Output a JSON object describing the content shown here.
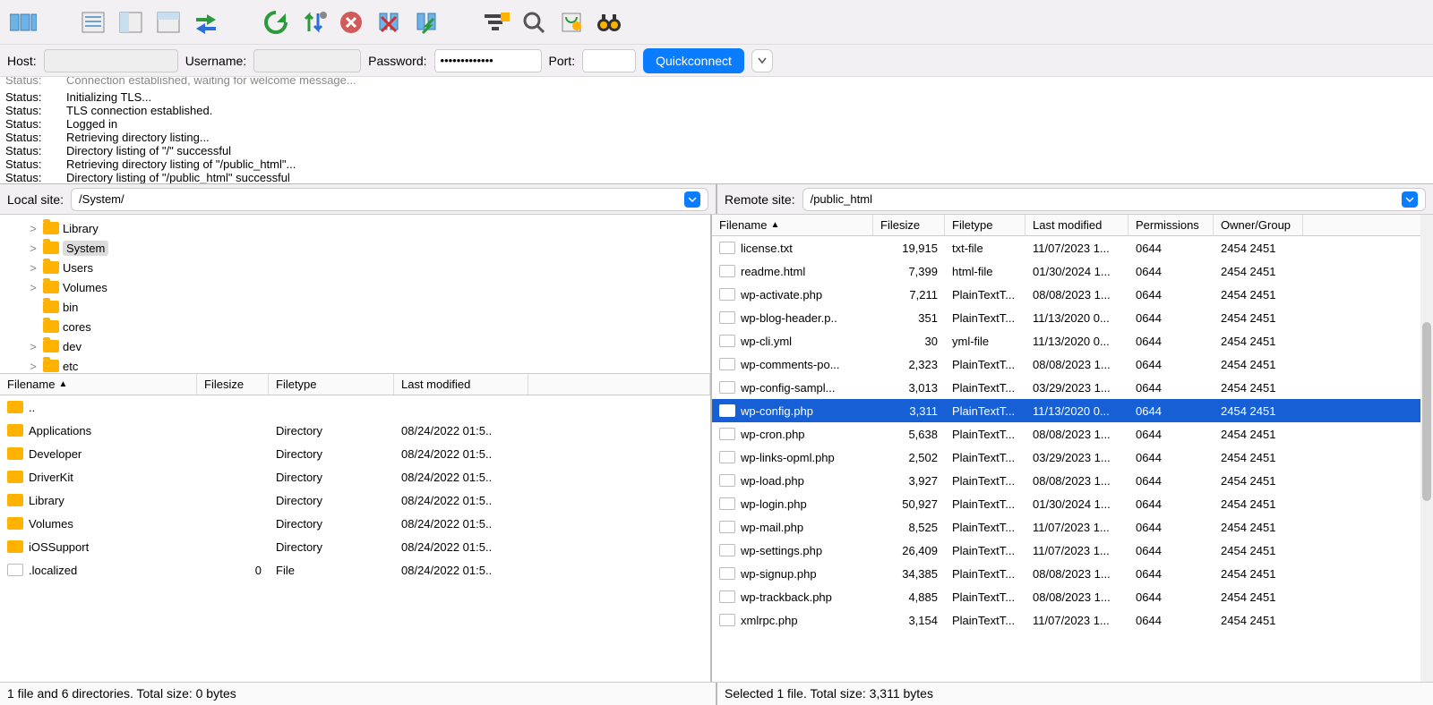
{
  "quickconnect": {
    "host_label": "Host:",
    "username_label": "Username:",
    "password_label": "Password:",
    "port_label": "Port:",
    "button": "Quickconnect",
    "password_mask": "•••••••••••••"
  },
  "log": [
    {
      "k": "Status:",
      "v": "Connection established, waiting for welcome message..."
    },
    {
      "k": "Status:",
      "v": "Initializing TLS..."
    },
    {
      "k": "Status:",
      "v": "TLS connection established."
    },
    {
      "k": "Status:",
      "v": "Logged in"
    },
    {
      "k": "Status:",
      "v": "Retrieving directory listing..."
    },
    {
      "k": "Status:",
      "v": "Directory listing of \"/\" successful"
    },
    {
      "k": "Status:",
      "v": "Retrieving directory listing of \"/public_html\"..."
    },
    {
      "k": "Status:",
      "v": "Directory listing of \"/public_html\" successful"
    }
  ],
  "local": {
    "site_label": "Local site:",
    "path": "/System/",
    "tree": [
      {
        "expander": ">",
        "name": "Library",
        "sel": false
      },
      {
        "expander": ">",
        "name": "System",
        "sel": true
      },
      {
        "expander": ">",
        "name": "Users",
        "sel": false
      },
      {
        "expander": ">",
        "name": "Volumes",
        "sel": false
      },
      {
        "expander": "",
        "name": "bin",
        "sel": false
      },
      {
        "expander": "",
        "name": "cores",
        "sel": false
      },
      {
        "expander": ">",
        "name": "dev",
        "sel": false
      },
      {
        "expander": ">",
        "name": "etc",
        "sel": false
      }
    ],
    "cols": {
      "name": "Filename",
      "size": "Filesize",
      "type": "Filetype",
      "mod": "Last modified"
    },
    "files": [
      {
        "icon": "folder",
        "name": "..",
        "size": "",
        "type": "",
        "mod": ""
      },
      {
        "icon": "folder",
        "name": "Applications",
        "size": "",
        "type": "Directory",
        "mod": "08/24/2022 01:5.."
      },
      {
        "icon": "folder",
        "name": "Developer",
        "size": "",
        "type": "Directory",
        "mod": "08/24/2022 01:5.."
      },
      {
        "icon": "folder",
        "name": "DriverKit",
        "size": "",
        "type": "Directory",
        "mod": "08/24/2022 01:5.."
      },
      {
        "icon": "folder",
        "name": "Library",
        "size": "",
        "type": "Directory",
        "mod": "08/24/2022 01:5.."
      },
      {
        "icon": "folder",
        "name": "Volumes",
        "size": "",
        "type": "Directory",
        "mod": "08/24/2022 01:5.."
      },
      {
        "icon": "folder",
        "name": "iOSSupport",
        "size": "",
        "type": "Directory",
        "mod": "08/24/2022 01:5.."
      },
      {
        "icon": "file",
        "name": ".localized",
        "size": "0",
        "type": "File",
        "mod": "08/24/2022 01:5.."
      }
    ],
    "footer": "1 file and 6 directories. Total size: 0 bytes"
  },
  "remote": {
    "site_label": "Remote site:",
    "path": "/public_html",
    "cols": {
      "name": "Filename",
      "size": "Filesize",
      "type": "Filetype",
      "mod": "Last modified",
      "perm": "Permissions",
      "own": "Owner/Group"
    },
    "files": [
      {
        "icon": "file",
        "name": "license.txt",
        "size": "19,915",
        "type": "txt-file",
        "mod": "11/07/2023 1...",
        "perm": "0644",
        "own": "2454 2451",
        "sel": false
      },
      {
        "icon": "file",
        "name": "readme.html",
        "size": "7,399",
        "type": "html-file",
        "mod": "01/30/2024 1...",
        "perm": "0644",
        "own": "2454 2451",
        "sel": false
      },
      {
        "icon": "file",
        "name": "wp-activate.php",
        "size": "7,211",
        "type": "PlainTextT...",
        "mod": "08/08/2023 1...",
        "perm": "0644",
        "own": "2454 2451",
        "sel": false
      },
      {
        "icon": "file",
        "name": "wp-blog-header.p..",
        "size": "351",
        "type": "PlainTextT...",
        "mod": "11/13/2020 0...",
        "perm": "0644",
        "own": "2454 2451",
        "sel": false
      },
      {
        "icon": "file",
        "name": "wp-cli.yml",
        "size": "30",
        "type": "yml-file",
        "mod": "11/13/2020 0...",
        "perm": "0644",
        "own": "2454 2451",
        "sel": false
      },
      {
        "icon": "file",
        "name": "wp-comments-po...",
        "size": "2,323",
        "type": "PlainTextT...",
        "mod": "08/08/2023 1...",
        "perm": "0644",
        "own": "2454 2451",
        "sel": false
      },
      {
        "icon": "file",
        "name": "wp-config-sampl...",
        "size": "3,013",
        "type": "PlainTextT...",
        "mod": "03/29/2023 1...",
        "perm": "0644",
        "own": "2454 2451",
        "sel": false
      },
      {
        "icon": "file",
        "name": "wp-config.php",
        "size": "3,311",
        "type": "PlainTextT...",
        "mod": "11/13/2020 0...",
        "perm": "0644",
        "own": "2454 2451",
        "sel": true
      },
      {
        "icon": "file",
        "name": "wp-cron.php",
        "size": "5,638",
        "type": "PlainTextT...",
        "mod": "08/08/2023 1...",
        "perm": "0644",
        "own": "2454 2451",
        "sel": false
      },
      {
        "icon": "file",
        "name": "wp-links-opml.php",
        "size": "2,502",
        "type": "PlainTextT...",
        "mod": "03/29/2023 1...",
        "perm": "0644",
        "own": "2454 2451",
        "sel": false
      },
      {
        "icon": "file",
        "name": "wp-load.php",
        "size": "3,927",
        "type": "PlainTextT...",
        "mod": "08/08/2023 1...",
        "perm": "0644",
        "own": "2454 2451",
        "sel": false
      },
      {
        "icon": "file",
        "name": "wp-login.php",
        "size": "50,927",
        "type": "PlainTextT...",
        "mod": "01/30/2024 1...",
        "perm": "0644",
        "own": "2454 2451",
        "sel": false
      },
      {
        "icon": "file",
        "name": "wp-mail.php",
        "size": "8,525",
        "type": "PlainTextT...",
        "mod": "11/07/2023 1...",
        "perm": "0644",
        "own": "2454 2451",
        "sel": false
      },
      {
        "icon": "file",
        "name": "wp-settings.php",
        "size": "26,409",
        "type": "PlainTextT...",
        "mod": "11/07/2023 1...",
        "perm": "0644",
        "own": "2454 2451",
        "sel": false
      },
      {
        "icon": "file",
        "name": "wp-signup.php",
        "size": "34,385",
        "type": "PlainTextT...",
        "mod": "08/08/2023 1...",
        "perm": "0644",
        "own": "2454 2451",
        "sel": false
      },
      {
        "icon": "file",
        "name": "wp-trackback.php",
        "size": "4,885",
        "type": "PlainTextT...",
        "mod": "08/08/2023 1...",
        "perm": "0644",
        "own": "2454 2451",
        "sel": false
      },
      {
        "icon": "file",
        "name": "xmlrpc.php",
        "size": "3,154",
        "type": "PlainTextT...",
        "mod": "11/07/2023 1...",
        "perm": "0644",
        "own": "2454 2451",
        "sel": false
      }
    ],
    "footer": "Selected 1 file. Total size: 3,311 bytes"
  }
}
